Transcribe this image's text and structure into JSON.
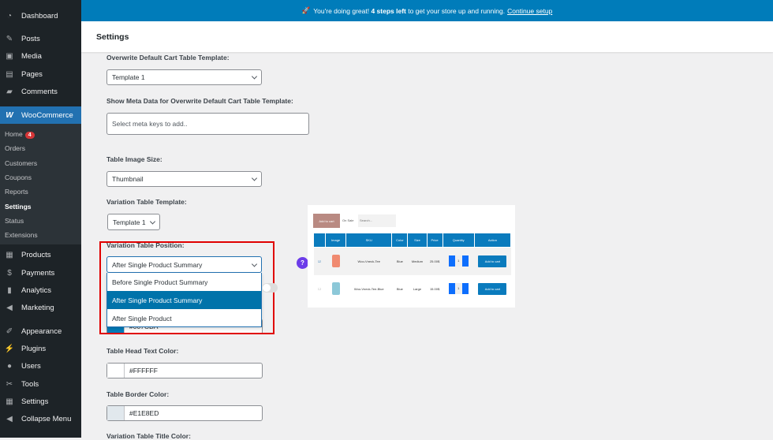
{
  "notice": {
    "text_before": "You're doing great!",
    "bold": "4 steps left",
    "text_after": "to get your store up and running.",
    "link": "Continue setup"
  },
  "header": {
    "title": "Settings"
  },
  "sidebar": {
    "items": [
      {
        "label": "Dashboard",
        "icon": "dashboard-icon"
      },
      {
        "label": "Posts",
        "icon": "pin-icon"
      },
      {
        "label": "Media",
        "icon": "media-icon"
      },
      {
        "label": "Pages",
        "icon": "pages-icon"
      },
      {
        "label": "Comments",
        "icon": "comment-icon"
      },
      {
        "label": "WooCommerce",
        "icon": "woo-icon"
      },
      {
        "label": "Products",
        "icon": "products-icon"
      },
      {
        "label": "Payments",
        "icon": "payments-icon"
      },
      {
        "label": "Analytics",
        "icon": "analytics-icon"
      },
      {
        "label": "Marketing",
        "icon": "megaphone-icon"
      },
      {
        "label": "Appearance",
        "icon": "brush-icon"
      },
      {
        "label": "Plugins",
        "icon": "plugin-icon"
      },
      {
        "label": "Users",
        "icon": "user-icon"
      },
      {
        "label": "Tools",
        "icon": "wrench-icon"
      },
      {
        "label": "Settings",
        "icon": "settings-icon"
      },
      {
        "label": "Collapse Menu",
        "icon": "collapse-icon"
      }
    ],
    "submenu": [
      "Home",
      "Orders",
      "Customers",
      "Coupons",
      "Reports",
      "Settings",
      "Status",
      "Extensions"
    ],
    "home_badge": "4"
  },
  "form": {
    "cart_template_label": "Overwrite Default Cart Table Template:",
    "cart_template_value": "Template 1",
    "meta_label": "Show Meta Data for Overwrite Default Cart Table Template:",
    "meta_placeholder": "Select meta keys to add..",
    "image_size_label": "Table Image Size:",
    "image_size_value": "Thumbnail",
    "variation_template_label": "Variation Table Template:",
    "variation_template_value": "Template 1",
    "position_label": "Variation Table Position:",
    "position_value": "After Single Product Summary",
    "position_options": [
      "Before Single Product Summary",
      "After Single Product Summary",
      "After Single Product"
    ],
    "head_bg_partial": "#007CBA",
    "head_text_label": "Table Head Text Color:",
    "head_text_value": "#FFFFFF",
    "border_label": "Table Border Color:",
    "border_value": "#E1E8ED",
    "title_color_label": "Variation Table Title Color:",
    "help": "?"
  },
  "colors": {
    "head_bg": "#007CBA",
    "head_text": "#FFFFFF",
    "border": "#E1E8ED"
  },
  "preview": {
    "add_to_cart": "Add to cart",
    "on_sale": "On Sale",
    "search_placeholder": "Search...",
    "headers": [
      "",
      "Image",
      "SKU",
      "Color",
      "Size",
      "Price",
      "Quantity",
      "Action"
    ],
    "rows": [
      {
        "sku": "Woo-Vneck-Tee",
        "color": "Blue",
        "size": "Medium",
        "price": "25.00$",
        "qty": "1",
        "action": "Add to cart",
        "checked": true,
        "shirt": "#f08a70"
      },
      {
        "sku": "Woo-Vneck-Tee-Blue",
        "color": "Blue",
        "size": "Large",
        "price": "15.00$",
        "qty": "1",
        "action": "Add to cart",
        "checked": false,
        "shirt": "#8cc8d8"
      }
    ],
    "minus": "-",
    "plus": "+"
  }
}
